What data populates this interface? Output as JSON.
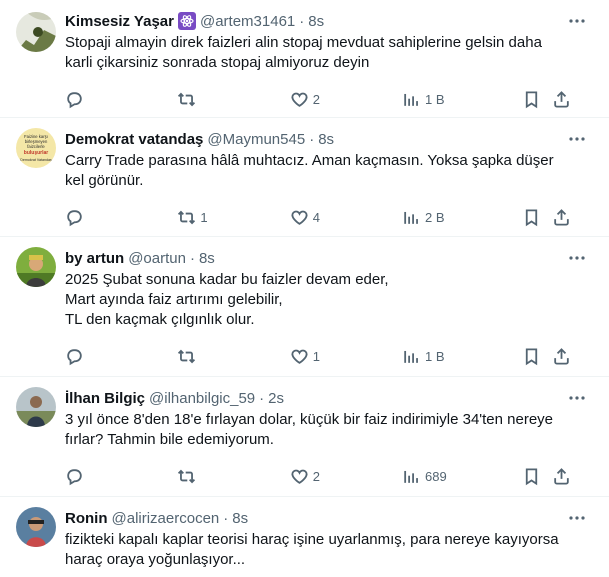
{
  "tweets": [
    {
      "name": "Kimsesiz Yaşar",
      "handle": "@artem31461",
      "time": "8s",
      "text": "Stopaji almayin direk faizleri alin stopaj mevduat sahiplerine gelsin daha\nkarli çikarsiniz sonrada stopaj almiyoruz deyin",
      "replies": "",
      "retweets": "",
      "likes": "2",
      "views": "1 B",
      "badge_icon": "atom-badge-icon"
    },
    {
      "name": "Demokrat vatandaş",
      "handle": "@Maymun545",
      "time": "8s",
      "text": "Carry Trade parasına hâlâ muhtacız. Aman kaçmasın. Yoksa şapka düşer\nkel görünür.",
      "replies": "",
      "retweets": "1",
      "likes": "4",
      "views": "2 B"
    },
    {
      "name": "by artun",
      "handle": "@oartun",
      "time": "8s",
      "text": "2025 Şubat sonuna kadar bu faizler devam eder,\nMart ayında faiz artırımı gelebilir,\nTL den kaçmak çılgınlık olur.",
      "replies": "",
      "retweets": "",
      "likes": "1",
      "views": "1 B"
    },
    {
      "name": "İlhan Bilgiç",
      "handle": "@ilhanbilgic_59",
      "time": "2s",
      "text": "3 yıl önce 8'den 18'e fırlayan dolar, küçük bir faiz indirimiyle 34'ten  nereye\nfırlar? Tahmin bile edemiyorum.",
      "replies": "",
      "retweets": "",
      "likes": "2",
      "views": "689"
    },
    {
      "name": "Ronin",
      "handle": "@alirizaercocen",
      "time": "8s",
      "text": "fizikteki kapalı kaplar teorisi haraç işine uyarlanmış, para nereye kayıyorsa\nharaç oraya yoğunlaşıyor...",
      "replies": "",
      "retweets": "",
      "likes": "",
      "views": ""
    }
  ],
  "avatar2_text": [
    "Faizine karşı",
    "birleşmeyen",
    "faizcilerle",
    "buluşurlar",
    "Demokrat Vatandaş"
  ],
  "colors": {
    "text": "#0f1419",
    "muted": "#536471",
    "divider": "#eff3f4",
    "badge": "#794bc4"
  }
}
